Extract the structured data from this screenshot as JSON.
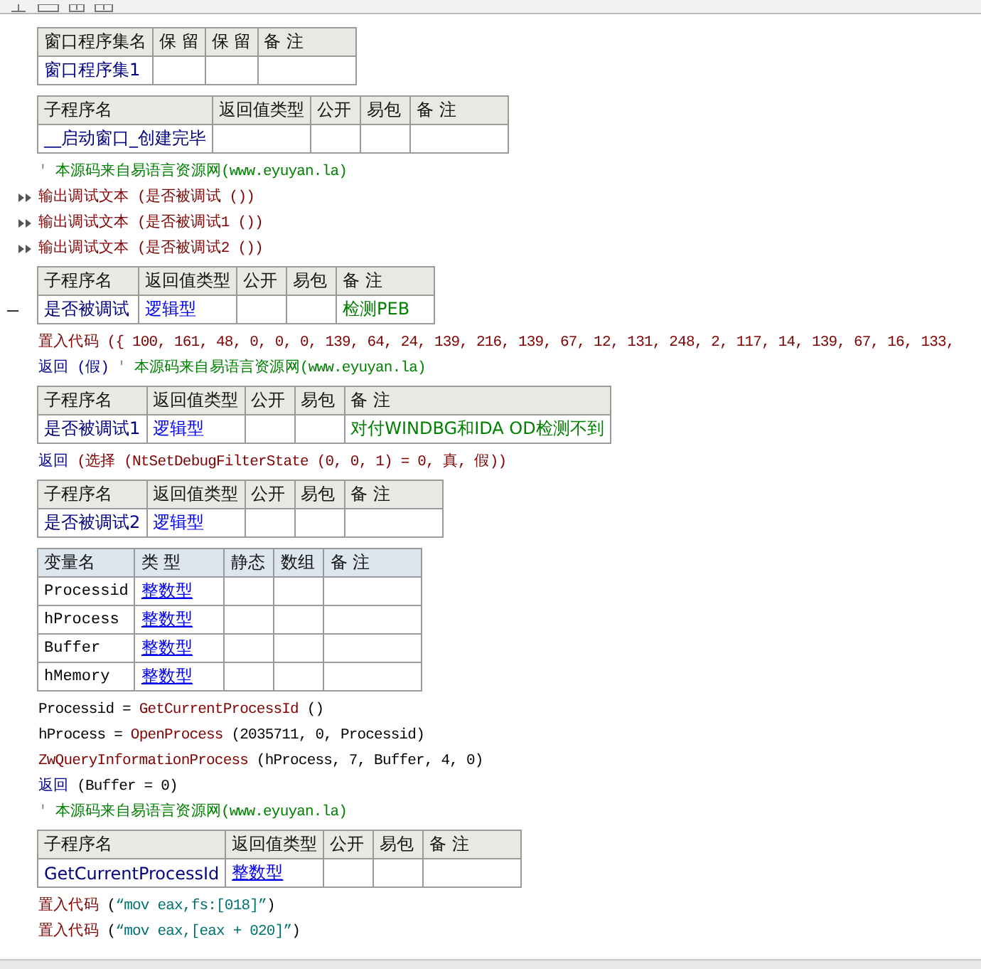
{
  "blocks": [
    {
      "kind": "assembly",
      "columns": [
        {
          "label": "窗口程序集名",
          "kind": "name"
        },
        {
          "label": "保 留",
          "kind": "flag"
        },
        {
          "label": "保 留",
          "kind": "flag"
        },
        {
          "label": "备 注",
          "kind": "comment"
        }
      ],
      "rows": [
        {
          "cells": [
            {
              "text": "窗口程序集1"
            },
            {},
            {},
            {}
          ]
        }
      ]
    },
    {
      "kind": "subprogram",
      "columns": [
        {
          "label": "子程序名",
          "kind": "name"
        },
        {
          "label": "返回值类型",
          "kind": "type"
        },
        {
          "label": "公开",
          "kind": "flag"
        },
        {
          "label": "易包",
          "kind": "flag"
        },
        {
          "label": "备 注",
          "kind": "comment"
        }
      ],
      "rows": [
        {
          "cells": [
            {
              "text": "__启动窗口_创建完毕"
            },
            {},
            {},
            {},
            {}
          ]
        }
      ]
    },
    {
      "kind": "line",
      "segments": [
        {
          "text": "'",
          "kind": "quote"
        },
        {
          "text": "本源码来自易语言资源网(www.eyuyan.la)",
          "kind": "comment"
        }
      ]
    },
    {
      "kind": "arrowline",
      "segments": [
        {
          "text": "输出调试文本 (是否被调试 ())",
          "kind": "command"
        }
      ]
    },
    {
      "kind": "arrowline",
      "segments": [
        {
          "text": "输出调试文本 (是否被调试1 ())",
          "kind": "command"
        }
      ]
    },
    {
      "kind": "arrowline",
      "segments": [
        {
          "text": "输出调试文本 (是否被调试2 ())",
          "kind": "command"
        }
      ]
    },
    {
      "kind": "dashedsubprogram",
      "columns": [
        {
          "label": "子程序名",
          "kind": "name"
        },
        {
          "label": "返回值类型",
          "kind": "type"
        },
        {
          "label": "公开",
          "kind": "flag"
        },
        {
          "label": "易包",
          "kind": "flag"
        },
        {
          "label": "备 注",
          "kind": "comment"
        }
      ],
      "rows": [
        {
          "cells": [
            {
              "text": "是否被调试"
            },
            {
              "text": "逻辑型",
              "underlined": false
            },
            {},
            {},
            {
              "text": "检测PEB"
            }
          ]
        }
      ]
    },
    {
      "kind": "line",
      "segments": [
        {
          "text": "置入代码 ({ 100, 161, 48, 0, 0, 0, 139, 64, 24, 139, 216, 139, 67, 12, 131, 248, 2, 117, 14, 139, 67, 16, 133,",
          "kind": "command"
        }
      ]
    },
    {
      "kind": "line",
      "segments": [
        {
          "text": "返回 (假) ",
          "kind": "keyword"
        },
        {
          "text": "'",
          "kind": "quote"
        },
        {
          "text": "本源码来自易语言资源网(www.eyuyan.la)",
          "kind": "comment"
        }
      ]
    },
    {
      "kind": "subprogram",
      "columns": [
        {
          "label": "子程序名",
          "kind": "name"
        },
        {
          "label": "返回值类型",
          "kind": "type"
        },
        {
          "label": "公开",
          "kind": "flag"
        },
        {
          "label": "易包",
          "kind": "flag"
        },
        {
          "label": "备 注",
          "kind": "comment"
        }
      ],
      "rows": [
        {
          "cells": [
            {
              "text": "是否被调试1"
            },
            {
              "text": "逻辑型",
              "underlined": false
            },
            {},
            {},
            {
              "text": "对付WINDBG和IDA   OD检测不到"
            }
          ]
        }
      ]
    },
    {
      "kind": "line",
      "segments": [
        {
          "text": "返回",
          "kind": "keyword"
        },
        {
          "text": " (选择 (NtSetDebugFilterState (0, 0, 1) = 0, 真, 假))",
          "kind": "command"
        }
      ]
    },
    {
      "kind": "subprogram",
      "columns": [
        {
          "label": "子程序名",
          "kind": "name"
        },
        {
          "label": "返回值类型",
          "kind": "type"
        },
        {
          "label": "公开",
          "kind": "flag"
        },
        {
          "label": "易包",
          "kind": "flag"
        },
        {
          "label": "备 注",
          "kind": "comment"
        }
      ],
      "rows": [
        {
          "cells": [
            {
              "text": "是否被调试2"
            },
            {
              "text": "逻辑型",
              "underlined": false
            },
            {},
            {},
            {}
          ]
        }
      ]
    },
    {
      "kind": "locals",
      "columns": [
        {
          "label": "变量名",
          "kind": "var"
        },
        {
          "label": "类 型",
          "kind": "type"
        },
        {
          "label": "静态",
          "kind": "flag"
        },
        {
          "label": "数组",
          "kind": "flag"
        },
        {
          "label": "备 注",
          "kind": "comment"
        }
      ],
      "rows": [
        {
          "cells": [
            {
              "text": "Processid"
            },
            {
              "text": "整数型",
              "underlined": true
            },
            {},
            {},
            {}
          ]
        },
        {
          "cells": [
            {
              "text": "hProcess"
            },
            {
              "text": "整数型",
              "underlined": true
            },
            {},
            {},
            {}
          ]
        },
        {
          "cells": [
            {
              "text": "Buffer"
            },
            {
              "text": "整数型",
              "underlined": true
            },
            {},
            {},
            {}
          ]
        },
        {
          "cells": [
            {
              "text": "hMemory"
            },
            {
              "text": "整数型",
              "underlined": true
            },
            {},
            {},
            {}
          ]
        }
      ]
    },
    {
      "kind": "line",
      "segments": [
        {
          "text": "Processid = ",
          "kind": "plain"
        },
        {
          "text": "GetCurrentProcessId",
          "kind": "command"
        },
        {
          "text": " ()",
          "kind": "plain"
        }
      ]
    },
    {
      "kind": "line",
      "segments": [
        {
          "text": "hProcess = ",
          "kind": "plain"
        },
        {
          "text": "OpenProcess",
          "kind": "command"
        },
        {
          "text": " (2035711, 0, Processid)",
          "kind": "plain"
        }
      ]
    },
    {
      "kind": "line",
      "segments": [
        {
          "text": "ZwQueryInformationProcess",
          "kind": "command"
        },
        {
          "text": " (hProcess, 7, Buffer, 4, 0)",
          "kind": "plain"
        }
      ]
    },
    {
      "kind": "line",
      "segments": [
        {
          "text": "返回",
          "kind": "keyword"
        },
        {
          "text": " (Buffer = 0)",
          "kind": "plain"
        }
      ]
    },
    {
      "kind": "line",
      "segments": [
        {
          "text": "'",
          "kind": "quote"
        },
        {
          "text": "本源码来自易语言资源网(www.eyuyan.la)",
          "kind": "comment"
        }
      ]
    },
    {
      "kind": "subprogram",
      "columns": [
        {
          "label": "子程序名",
          "kind": "name"
        },
        {
          "label": "返回值类型",
          "kind": "type"
        },
        {
          "label": "公开",
          "kind": "flag"
        },
        {
          "label": "易包",
          "kind": "flag"
        },
        {
          "label": "备 注",
          "kind": "comment"
        }
      ],
      "rows": [
        {
          "cells": [
            {
              "text": "GetCurrentProcessId"
            },
            {
              "text": "整数型",
              "underlined": true
            },
            {},
            {},
            {}
          ]
        }
      ]
    },
    {
      "kind": "line",
      "segments": [
        {
          "text": "置入代码",
          "kind": "command"
        },
        {
          "text": " (",
          "kind": "plain"
        },
        {
          "text": "“mov eax,fs:[018]”",
          "kind": "string"
        },
        {
          "text": ")",
          "kind": "plain"
        }
      ]
    },
    {
      "kind": "line",
      "segments": [
        {
          "text": "置入代码",
          "kind": "command"
        },
        {
          "text": " (",
          "kind": "plain"
        },
        {
          "text": "“mov eax,[eax + 020]”",
          "kind": "string"
        },
        {
          "text": ")",
          "kind": "plain"
        }
      ]
    }
  ]
}
